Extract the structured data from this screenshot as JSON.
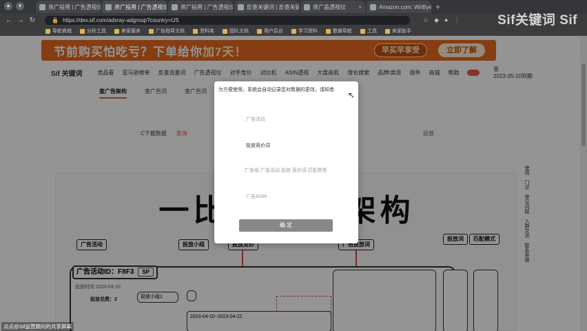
{
  "browser": {
    "tabs": [
      {
        "label": "资广投用 | 广告透视仪",
        "active": false
      },
      {
        "label": "资广投用 | 广告透视仪",
        "active": true
      },
      {
        "label": "资广投用 | 广告透视仪",
        "active": false
      },
      {
        "label": "反查关键词 | 反查关键",
        "active": false
      },
      {
        "label": "资广品透视仪",
        "active": false
      },
      {
        "label": "Amazon.com: WirBye",
        "active": false
      }
    ],
    "url": "https://dev.sif.com/adxray-adgroup?country=US",
    "bookmarks": [
      "导航商城",
      "分析工具",
      "卖家服务",
      "广告指导文档",
      "资料库",
      "团队文档",
      "用户后台",
      "学习资料",
      "数据导航",
      "工具",
      "卖家助手"
    ]
  },
  "brand_overlay": "Sif关键词 Sif",
  "page": {
    "banner": {
      "text_main": "节前购买怕吃亏？下单给你",
      "text_hl": "加7天！",
      "pill": "早买早享受",
      "cta": "立即了解"
    },
    "logo": "Sif 关键词",
    "nav": [
      "竞品看",
      "亚马逊榜单",
      "反查流量词",
      "广告透视仪",
      "对手竞价",
      "对比机",
      "ASIN透视",
      "大盘商机",
      "增长搜索",
      "品牌/类目"
    ],
    "nav_more": [
      "插件",
      "商城",
      "帮助"
    ],
    "user": {
      "name": "恩",
      "date": "2023-05-10到期"
    },
    "subtabs": [
      {
        "label": "查广告架构",
        "active": true
      },
      {
        "label": "查广告词",
        "active": false
      },
      {
        "label": "查广告词",
        "active": false
      }
    ],
    "filters": [
      "C下载数据",
      "查询",
      "投放"
    ],
    "canvas": {
      "title": "一比一 广告架构",
      "labels": [
        "广告活动",
        "投放小组",
        "投放竞价",
        "广告投放词",
        "投放词",
        "匹配模式"
      ],
      "campaign_id": "广告活动ID：F8F3",
      "campaign_tag": "SP",
      "campaign_budget": "投放花费：2",
      "group_select": "投放小组1",
      "date_range": "2023-04-10~2023-04-22",
      "sub_date": "投放时间 2023-04-10"
    },
    "sidebar": [
      "使用",
      "门诊",
      "常见问题",
      "入群交流",
      "联系客服"
    ]
  },
  "modal": {
    "message": "为方便使用，系统会自动记录您对数据的更改，请知悉",
    "fields": [
      "广告活动",
      "投放竞价词",
      "广告组 广告活动 投放 竞价词 匹配类型",
      "广告ASIN"
    ],
    "confirm": "确 定"
  },
  "watermark": "点点@Sif运营顾问的共享屏幕"
}
